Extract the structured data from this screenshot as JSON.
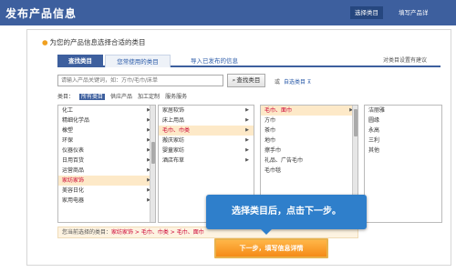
{
  "header": {
    "title": "发布产品信息",
    "steps": [
      "选择类目",
      "填写产品详"
    ]
  },
  "panel": {
    "heading": "为您的产品信息选择合适的类目",
    "tabs": [
      "查找类目",
      "您常使用的类目",
      "导入已发布的信息",
      "对类目设置有建议"
    ]
  },
  "search": {
    "placeholder": "请输入产品关键词，如：方巾/毛巾/床单",
    "button": "查找类目",
    "or": "或",
    "auto_link": "自选类目 ⊼"
  },
  "filter": {
    "label": "类目：",
    "options": [
      "所有类目",
      "供应产品",
      "加工定制",
      "服务服务"
    ]
  },
  "columns": [
    {
      "items": [
        {
          "label": "化工",
          "arrow": true,
          "hl": false
        },
        {
          "label": "精细化学品",
          "arrow": true,
          "hl": false
        },
        {
          "label": "橡塑",
          "arrow": true,
          "hl": false
        },
        {
          "label": "环保",
          "arrow": true,
          "hl": false
        },
        {
          "label": "仪器仪表",
          "arrow": true,
          "hl": false
        },
        {
          "label": "日用百货",
          "arrow": true,
          "hl": false
        },
        {
          "label": "运营商品",
          "arrow": true,
          "hl": false
        },
        {
          "label": "家纺家饰",
          "arrow": true,
          "hl": true
        },
        {
          "label": "美容日化",
          "arrow": true,
          "hl": false
        },
        {
          "label": "家用电器",
          "arrow": true,
          "hl": false
        }
      ]
    },
    {
      "items": [
        {
          "label": "家居软饰",
          "arrow": true,
          "hl": false
        },
        {
          "label": "床上用品",
          "arrow": true,
          "hl": false
        },
        {
          "label": "毛巾、巾类",
          "arrow": true,
          "hl": true
        },
        {
          "label": "搬庆家纺",
          "arrow": true,
          "hl": false
        },
        {
          "label": "婴童家纺",
          "arrow": true,
          "hl": false
        },
        {
          "label": "酒店布草",
          "arrow": true,
          "hl": false
        }
      ]
    },
    {
      "items": [
        {
          "label": "毛巾、面巾",
          "arrow": true,
          "hl": true
        },
        {
          "label": "方巾",
          "arrow": false,
          "hl": false
        },
        {
          "label": "茶巾",
          "arrow": false,
          "hl": false
        },
        {
          "label": "地巾",
          "arrow": false,
          "hl": false
        },
        {
          "label": "擦手巾",
          "arrow": false,
          "hl": false
        },
        {
          "label": "礼品、广告毛巾",
          "arrow": false,
          "hl": false
        },
        {
          "label": "毛巾毯",
          "arrow": false,
          "hl": false
        }
      ]
    },
    {
      "items": [
        {
          "label": "洁丽雅",
          "arrow": false,
          "hl": false
        },
        {
          "label": "圆缘",
          "arrow": false,
          "hl": false
        },
        {
          "label": "永高",
          "arrow": false,
          "hl": false
        },
        {
          "label": "三利",
          "arrow": false,
          "hl": false
        },
        {
          "label": "其他",
          "arrow": false,
          "hl": false
        }
      ]
    }
  ],
  "selected": {
    "prefix": "您当前选择的类目：",
    "path": "家纺家饰 > 毛巾、巾类 > 毛巾、面巾"
  },
  "tooltip": "选择类目后，点击下一步。",
  "next_button": "下一步，填写信息详情",
  "colors": {
    "header_bg": "#3d5f9e",
    "highlight_bg": "#fde9c8",
    "tooltip_bg": "#2f7fcb",
    "button_orange": "#f58a17"
  }
}
